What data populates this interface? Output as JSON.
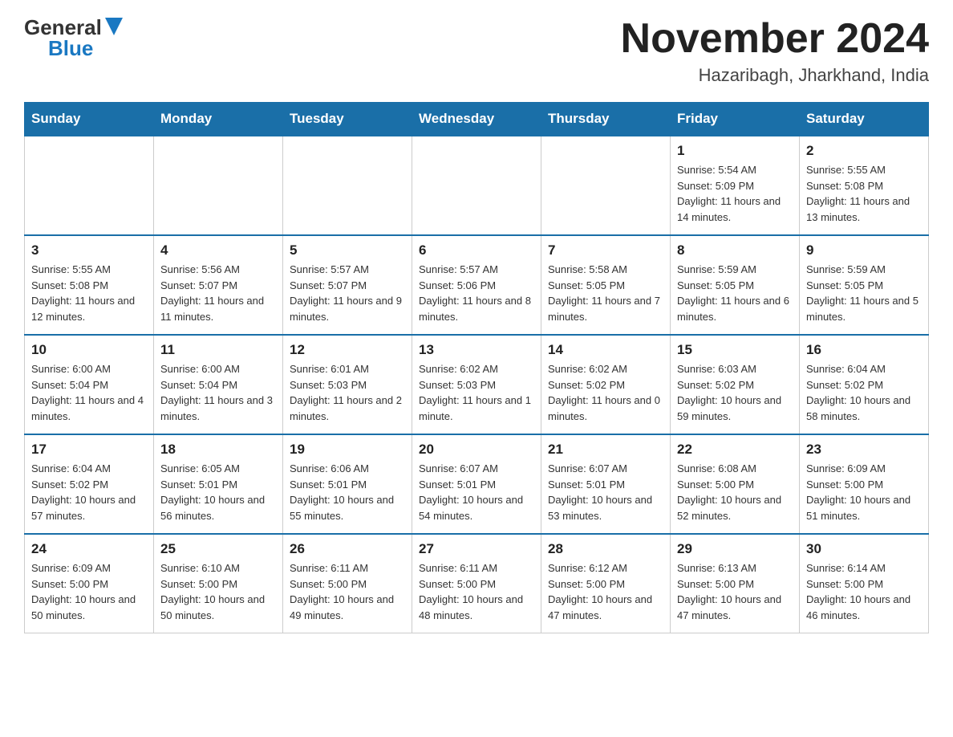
{
  "header": {
    "logo_general": "General",
    "logo_blue": "Blue",
    "month_title": "November 2024",
    "location": "Hazaribagh, Jharkhand, India"
  },
  "days_of_week": [
    "Sunday",
    "Monday",
    "Tuesday",
    "Wednesday",
    "Thursday",
    "Friday",
    "Saturday"
  ],
  "weeks": [
    [
      {
        "day": "",
        "info": ""
      },
      {
        "day": "",
        "info": ""
      },
      {
        "day": "",
        "info": ""
      },
      {
        "day": "",
        "info": ""
      },
      {
        "day": "",
        "info": ""
      },
      {
        "day": "1",
        "info": "Sunrise: 5:54 AM\nSunset: 5:09 PM\nDaylight: 11 hours and 14 minutes."
      },
      {
        "day": "2",
        "info": "Sunrise: 5:55 AM\nSunset: 5:08 PM\nDaylight: 11 hours and 13 minutes."
      }
    ],
    [
      {
        "day": "3",
        "info": "Sunrise: 5:55 AM\nSunset: 5:08 PM\nDaylight: 11 hours and 12 minutes."
      },
      {
        "day": "4",
        "info": "Sunrise: 5:56 AM\nSunset: 5:07 PM\nDaylight: 11 hours and 11 minutes."
      },
      {
        "day": "5",
        "info": "Sunrise: 5:57 AM\nSunset: 5:07 PM\nDaylight: 11 hours and 9 minutes."
      },
      {
        "day": "6",
        "info": "Sunrise: 5:57 AM\nSunset: 5:06 PM\nDaylight: 11 hours and 8 minutes."
      },
      {
        "day": "7",
        "info": "Sunrise: 5:58 AM\nSunset: 5:05 PM\nDaylight: 11 hours and 7 minutes."
      },
      {
        "day": "8",
        "info": "Sunrise: 5:59 AM\nSunset: 5:05 PM\nDaylight: 11 hours and 6 minutes."
      },
      {
        "day": "9",
        "info": "Sunrise: 5:59 AM\nSunset: 5:05 PM\nDaylight: 11 hours and 5 minutes."
      }
    ],
    [
      {
        "day": "10",
        "info": "Sunrise: 6:00 AM\nSunset: 5:04 PM\nDaylight: 11 hours and 4 minutes."
      },
      {
        "day": "11",
        "info": "Sunrise: 6:00 AM\nSunset: 5:04 PM\nDaylight: 11 hours and 3 minutes."
      },
      {
        "day": "12",
        "info": "Sunrise: 6:01 AM\nSunset: 5:03 PM\nDaylight: 11 hours and 2 minutes."
      },
      {
        "day": "13",
        "info": "Sunrise: 6:02 AM\nSunset: 5:03 PM\nDaylight: 11 hours and 1 minute."
      },
      {
        "day": "14",
        "info": "Sunrise: 6:02 AM\nSunset: 5:02 PM\nDaylight: 11 hours and 0 minutes."
      },
      {
        "day": "15",
        "info": "Sunrise: 6:03 AM\nSunset: 5:02 PM\nDaylight: 10 hours and 59 minutes."
      },
      {
        "day": "16",
        "info": "Sunrise: 6:04 AM\nSunset: 5:02 PM\nDaylight: 10 hours and 58 minutes."
      }
    ],
    [
      {
        "day": "17",
        "info": "Sunrise: 6:04 AM\nSunset: 5:02 PM\nDaylight: 10 hours and 57 minutes."
      },
      {
        "day": "18",
        "info": "Sunrise: 6:05 AM\nSunset: 5:01 PM\nDaylight: 10 hours and 56 minutes."
      },
      {
        "day": "19",
        "info": "Sunrise: 6:06 AM\nSunset: 5:01 PM\nDaylight: 10 hours and 55 minutes."
      },
      {
        "day": "20",
        "info": "Sunrise: 6:07 AM\nSunset: 5:01 PM\nDaylight: 10 hours and 54 minutes."
      },
      {
        "day": "21",
        "info": "Sunrise: 6:07 AM\nSunset: 5:01 PM\nDaylight: 10 hours and 53 minutes."
      },
      {
        "day": "22",
        "info": "Sunrise: 6:08 AM\nSunset: 5:00 PM\nDaylight: 10 hours and 52 minutes."
      },
      {
        "day": "23",
        "info": "Sunrise: 6:09 AM\nSunset: 5:00 PM\nDaylight: 10 hours and 51 minutes."
      }
    ],
    [
      {
        "day": "24",
        "info": "Sunrise: 6:09 AM\nSunset: 5:00 PM\nDaylight: 10 hours and 50 minutes."
      },
      {
        "day": "25",
        "info": "Sunrise: 6:10 AM\nSunset: 5:00 PM\nDaylight: 10 hours and 50 minutes."
      },
      {
        "day": "26",
        "info": "Sunrise: 6:11 AM\nSunset: 5:00 PM\nDaylight: 10 hours and 49 minutes."
      },
      {
        "day": "27",
        "info": "Sunrise: 6:11 AM\nSunset: 5:00 PM\nDaylight: 10 hours and 48 minutes."
      },
      {
        "day": "28",
        "info": "Sunrise: 6:12 AM\nSunset: 5:00 PM\nDaylight: 10 hours and 47 minutes."
      },
      {
        "day": "29",
        "info": "Sunrise: 6:13 AM\nSunset: 5:00 PM\nDaylight: 10 hours and 47 minutes."
      },
      {
        "day": "30",
        "info": "Sunrise: 6:14 AM\nSunset: 5:00 PM\nDaylight: 10 hours and 46 minutes."
      }
    ]
  ]
}
